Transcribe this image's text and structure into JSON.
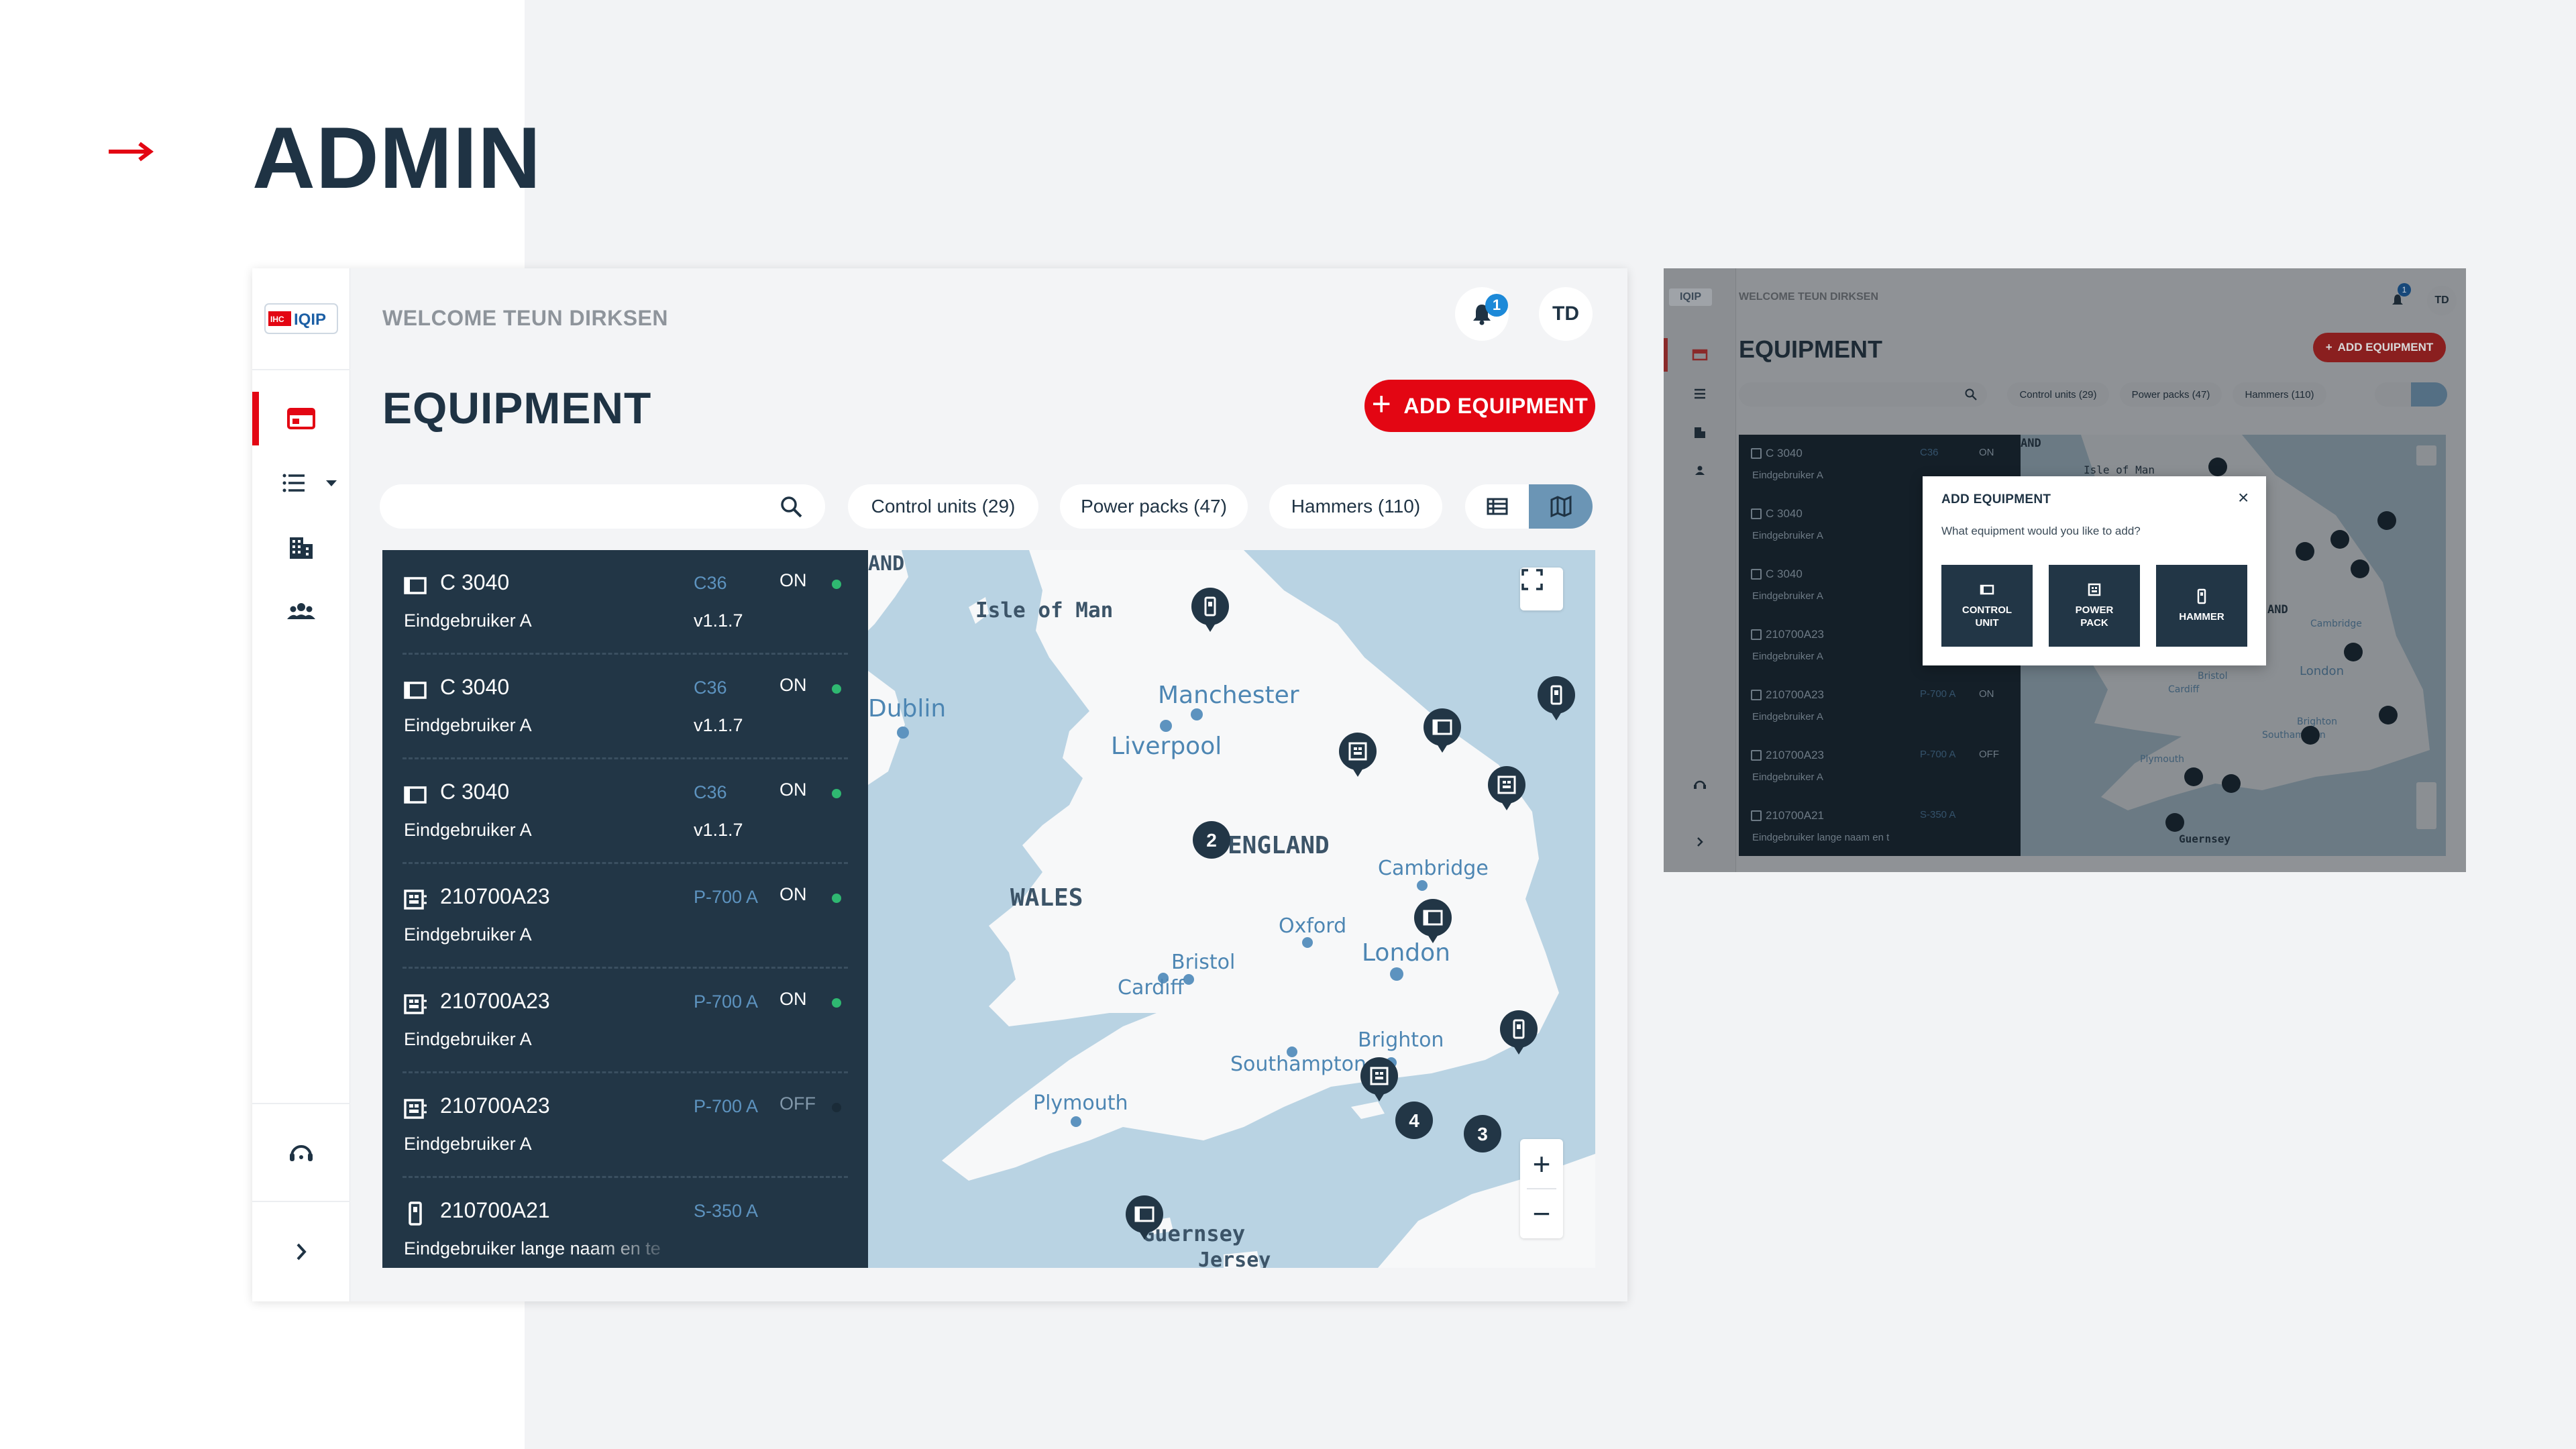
{
  "slide": {
    "title": "ADMIN",
    "accent": "#e30613",
    "dark": "#1f3344"
  },
  "app": {
    "logo_text": "IQIP",
    "welcome": "WELCOME TEUN DIRKSEN",
    "notifications": "1",
    "user_initials": "TD",
    "title": "EQUIPMENT",
    "add_label": "ADD EQUIPMENT",
    "search_placeholder": "",
    "filters": [
      "Control units (29)",
      "Power packs (47)",
      "Hammers (110)"
    ],
    "nav": [
      "dashboard-icon",
      "list-icon",
      "buildings-icon",
      "users-icon",
      "support-icon",
      "chevron-right-icon"
    ],
    "rows": [
      {
        "icon": "control-unit-icon",
        "name": "C 3040",
        "model": "C36",
        "state": "ON",
        "owner": "Eindgebruiker A",
        "version": "v1.1.7"
      },
      {
        "icon": "control-unit-icon",
        "name": "C 3040",
        "model": "C36",
        "state": "ON",
        "owner": "Eindgebruiker A",
        "version": "v1.1.7"
      },
      {
        "icon": "control-unit-icon",
        "name": "C 3040",
        "model": "C36",
        "state": "ON",
        "owner": "Eindgebruiker A",
        "version": "v1.1.7"
      },
      {
        "icon": "power-pack-icon",
        "name": "210700A23",
        "model": "P-700 A",
        "state": "ON",
        "owner": "Eindgebruiker A",
        "version": ""
      },
      {
        "icon": "power-pack-icon",
        "name": "210700A23",
        "model": "P-700 A",
        "state": "ON",
        "owner": "Eindgebruiker A",
        "version": ""
      },
      {
        "icon": "power-pack-icon",
        "name": "210700A23",
        "model": "P-700 A",
        "state": "OFF",
        "owner": "Eindgebruiker A",
        "version": ""
      },
      {
        "icon": "hammer-icon",
        "name": "210700A21",
        "model": "S-350 A",
        "state": "",
        "owner": "Eindgebruiker lange naam en te",
        "version": ""
      }
    ],
    "map": {
      "places": [
        "Isle of Man",
        "Manchester",
        "Dublin",
        "Liverpool",
        "ENGLAND",
        "WALES",
        "Cambridge",
        "Oxford",
        "London",
        "Bristol",
        "Cardiff",
        "Brighton",
        "Southampton",
        "Plymouth",
        "Guernsey",
        "Jersey",
        "AND"
      ],
      "clusters": [
        "2",
        "4",
        "3"
      ],
      "zoom_in": "+",
      "zoom_out": "−"
    }
  },
  "modal_screen": {
    "welcome": "WELCOME TEUN DIRKSEN",
    "title": "EQUIPMENT",
    "add_label": "ADD EQUIPMENT",
    "filters": [
      "Control units (29)",
      "Power packs (47)",
      "Hammers (110)"
    ],
    "user_initials": "TD",
    "notifications": "1",
    "rows": [
      {
        "name": "C 3040",
        "owner": "Eindgebruiker A",
        "model": "C36",
        "state": "ON"
      },
      {
        "name": "C 3040",
        "owner": "Eindgebruiker A",
        "model": "",
        "state": ""
      },
      {
        "name": "C 3040",
        "owner": "Eindgebruiker A",
        "model": "",
        "state": ""
      },
      {
        "name": "210700A23",
        "owner": "Eindgebruiker A",
        "model": "",
        "state": ""
      },
      {
        "name": "210700A23",
        "owner": "Eindgebruiker A",
        "model": "P-700 A",
        "state": "ON"
      },
      {
        "name": "210700A23",
        "owner": "Eindgebruiker A",
        "model": "P-700 A",
        "state": "OFF"
      },
      {
        "name": "210700A21",
        "owner": "Eindgebruiker lange naam en t",
        "model": "S-350 A",
        "state": ""
      }
    ],
    "map_places": [
      "AND",
      "Isle of Man",
      "AND",
      "Cambridge",
      "London",
      "Bristol",
      "Cardiff",
      "Brighton",
      "Southampton",
      "Plymouth",
      "Guernsey"
    ],
    "modal": {
      "title": "ADD EQUIPMENT",
      "question": "What equipment would you like to add?",
      "options": [
        "CONTROL\nUNIT",
        "POWER\nPACK",
        "HAMMER"
      ]
    }
  }
}
